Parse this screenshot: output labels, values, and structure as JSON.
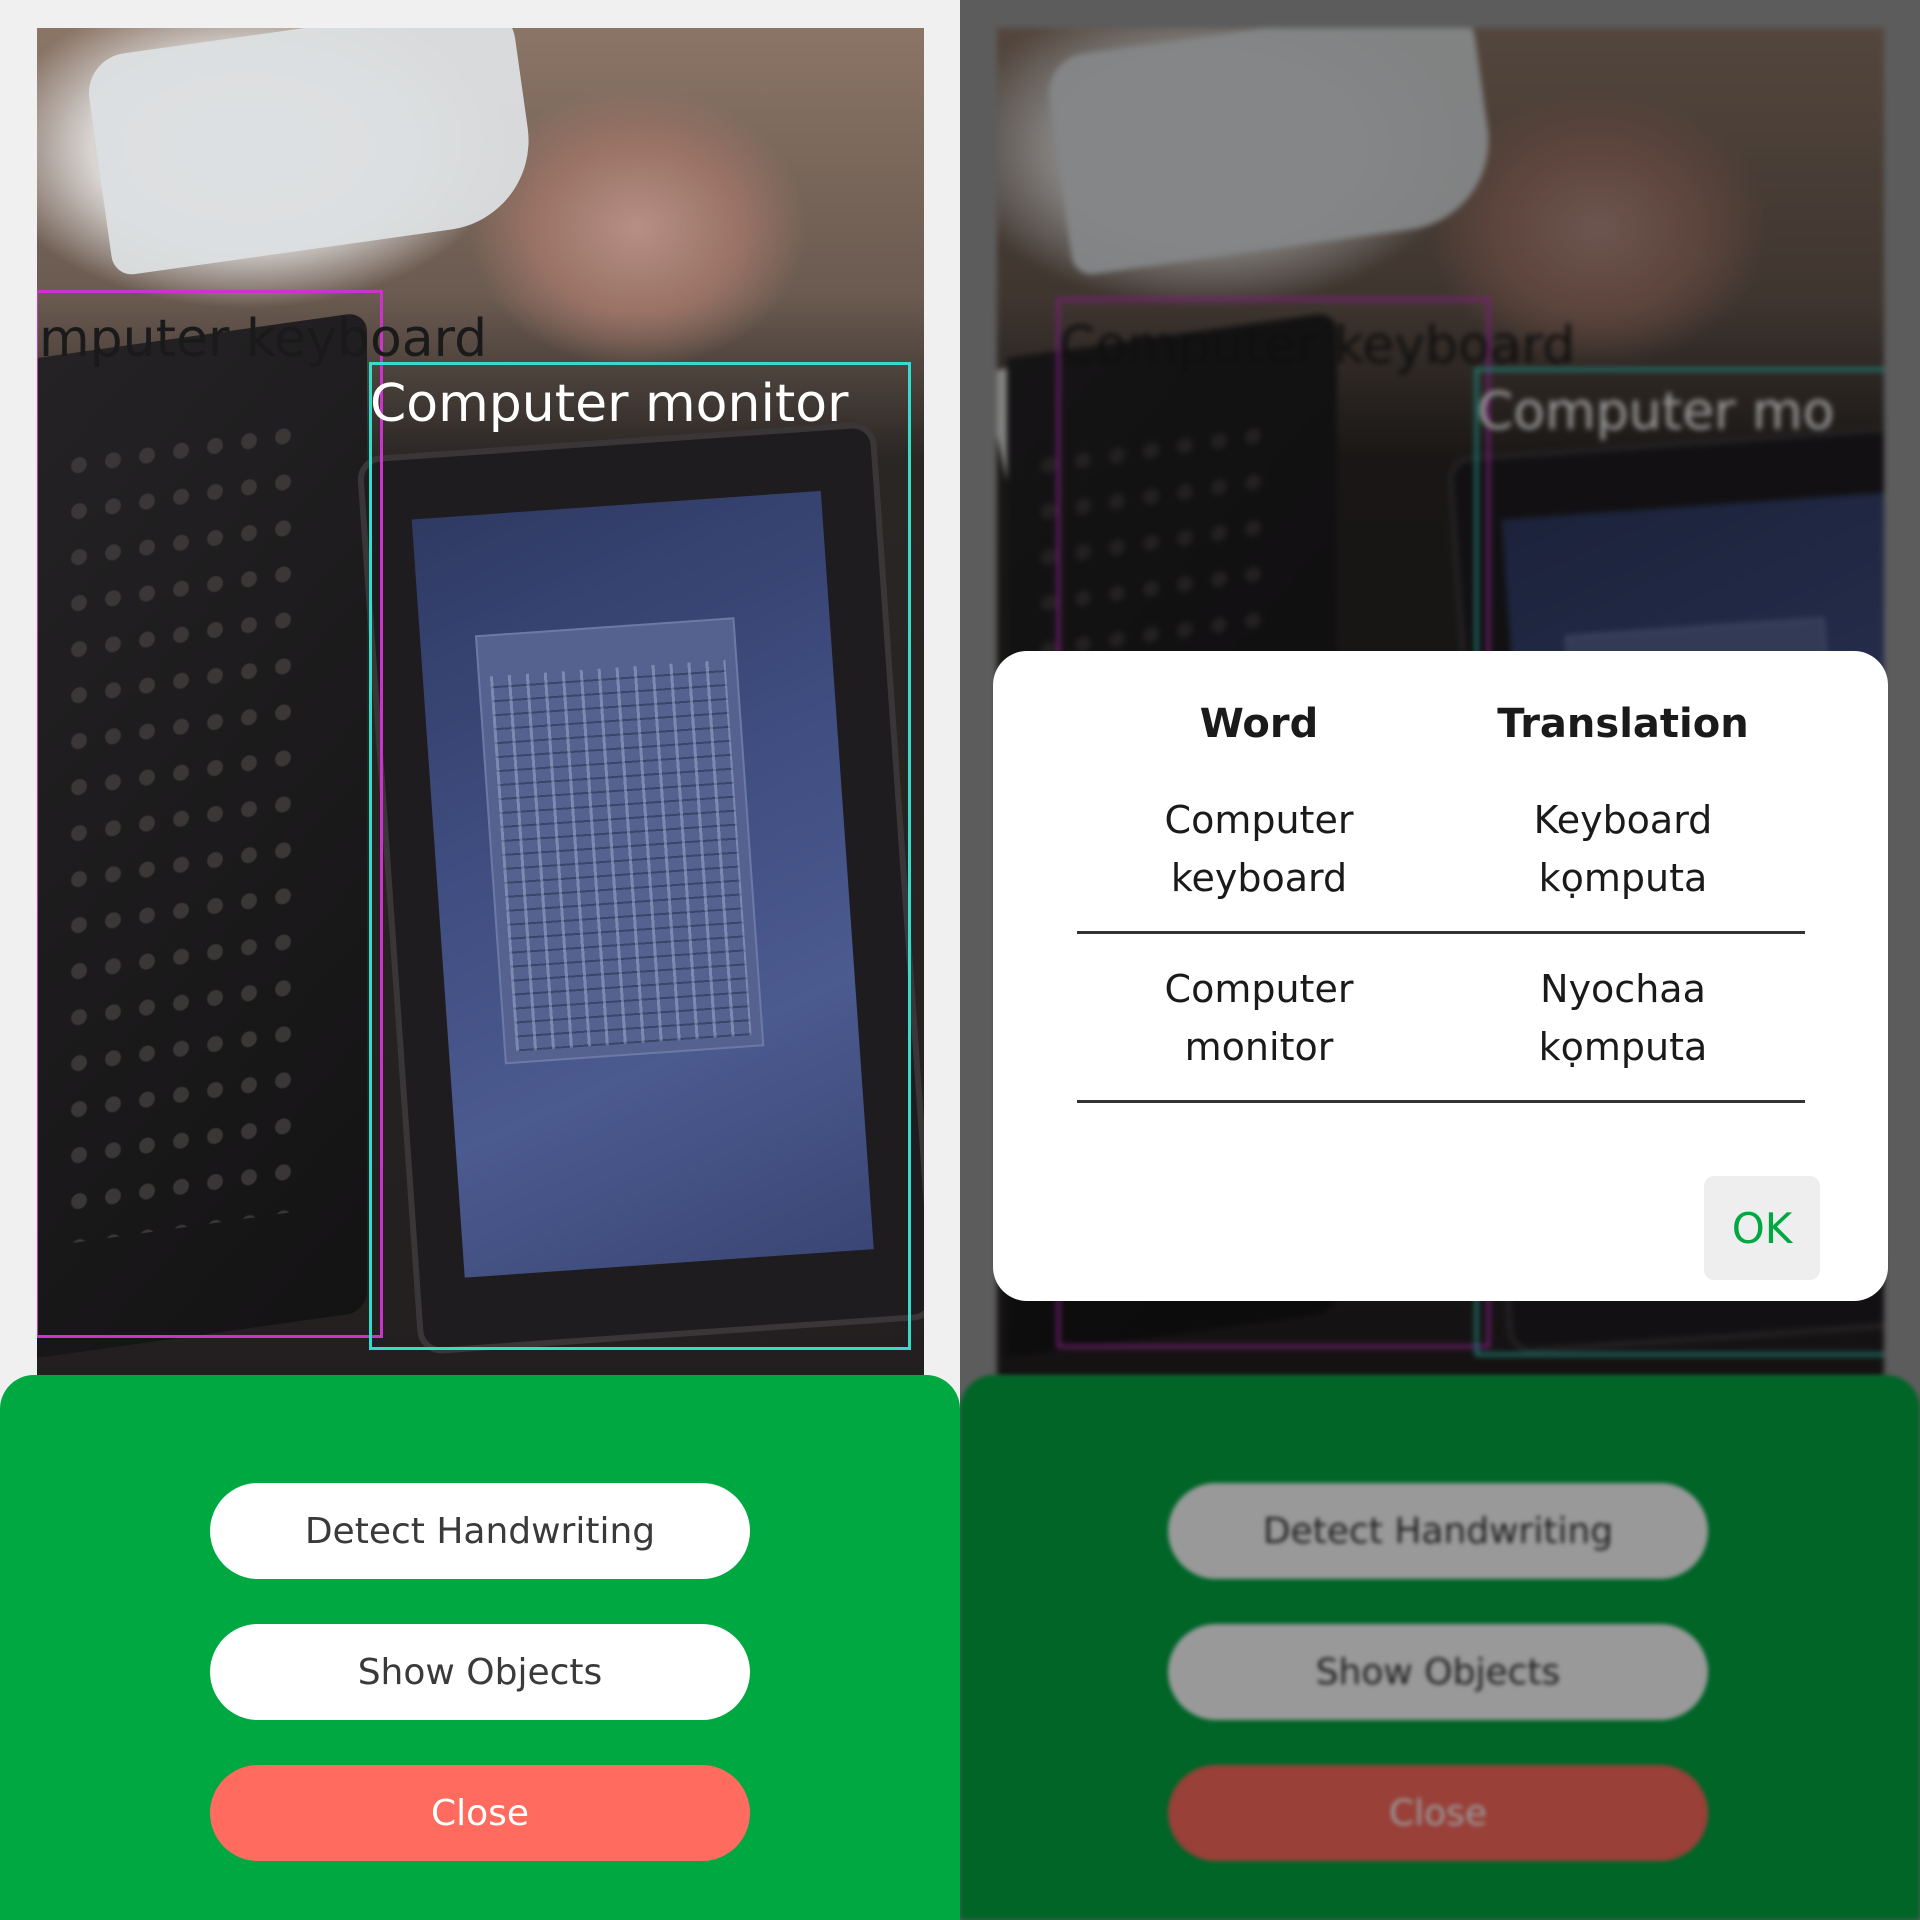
{
  "colors": {
    "sheet_green": "#00a842",
    "close_red": "#ff6b5e",
    "keyboard_box": "#cc33cc",
    "monitor_box": "#33ddcc"
  },
  "left_screen": {
    "detections": [
      {
        "label": "Computer keyboard",
        "visible_text": "mputer keyboard"
      },
      {
        "label": "Computer monitor",
        "visible_text": "Computer monitor"
      }
    ],
    "buttons": {
      "detect_handwriting": "Detect Handwriting",
      "show_objects": "Show Objects",
      "close": "Close"
    }
  },
  "right_screen": {
    "detections": [
      {
        "label": "Computer keyboard",
        "visible_text": "Computer keyboard"
      },
      {
        "label": "Computer monitor",
        "visible_text": "Computer mo"
      }
    ],
    "dialog": {
      "headers": {
        "word": "Word",
        "translation": "Translation"
      },
      "rows": [
        {
          "word": "Computer\nkeyboard",
          "translation": "Keyboard\nkọmputa"
        },
        {
          "word": "Computer\nmonitor",
          "translation": "Nyochaa\nkọmputa"
        }
      ],
      "ok_label": "OK"
    },
    "buttons": {
      "detect_handwriting": "Detect Handwriting",
      "show_objects": "Show Objects",
      "close": "Close"
    }
  }
}
